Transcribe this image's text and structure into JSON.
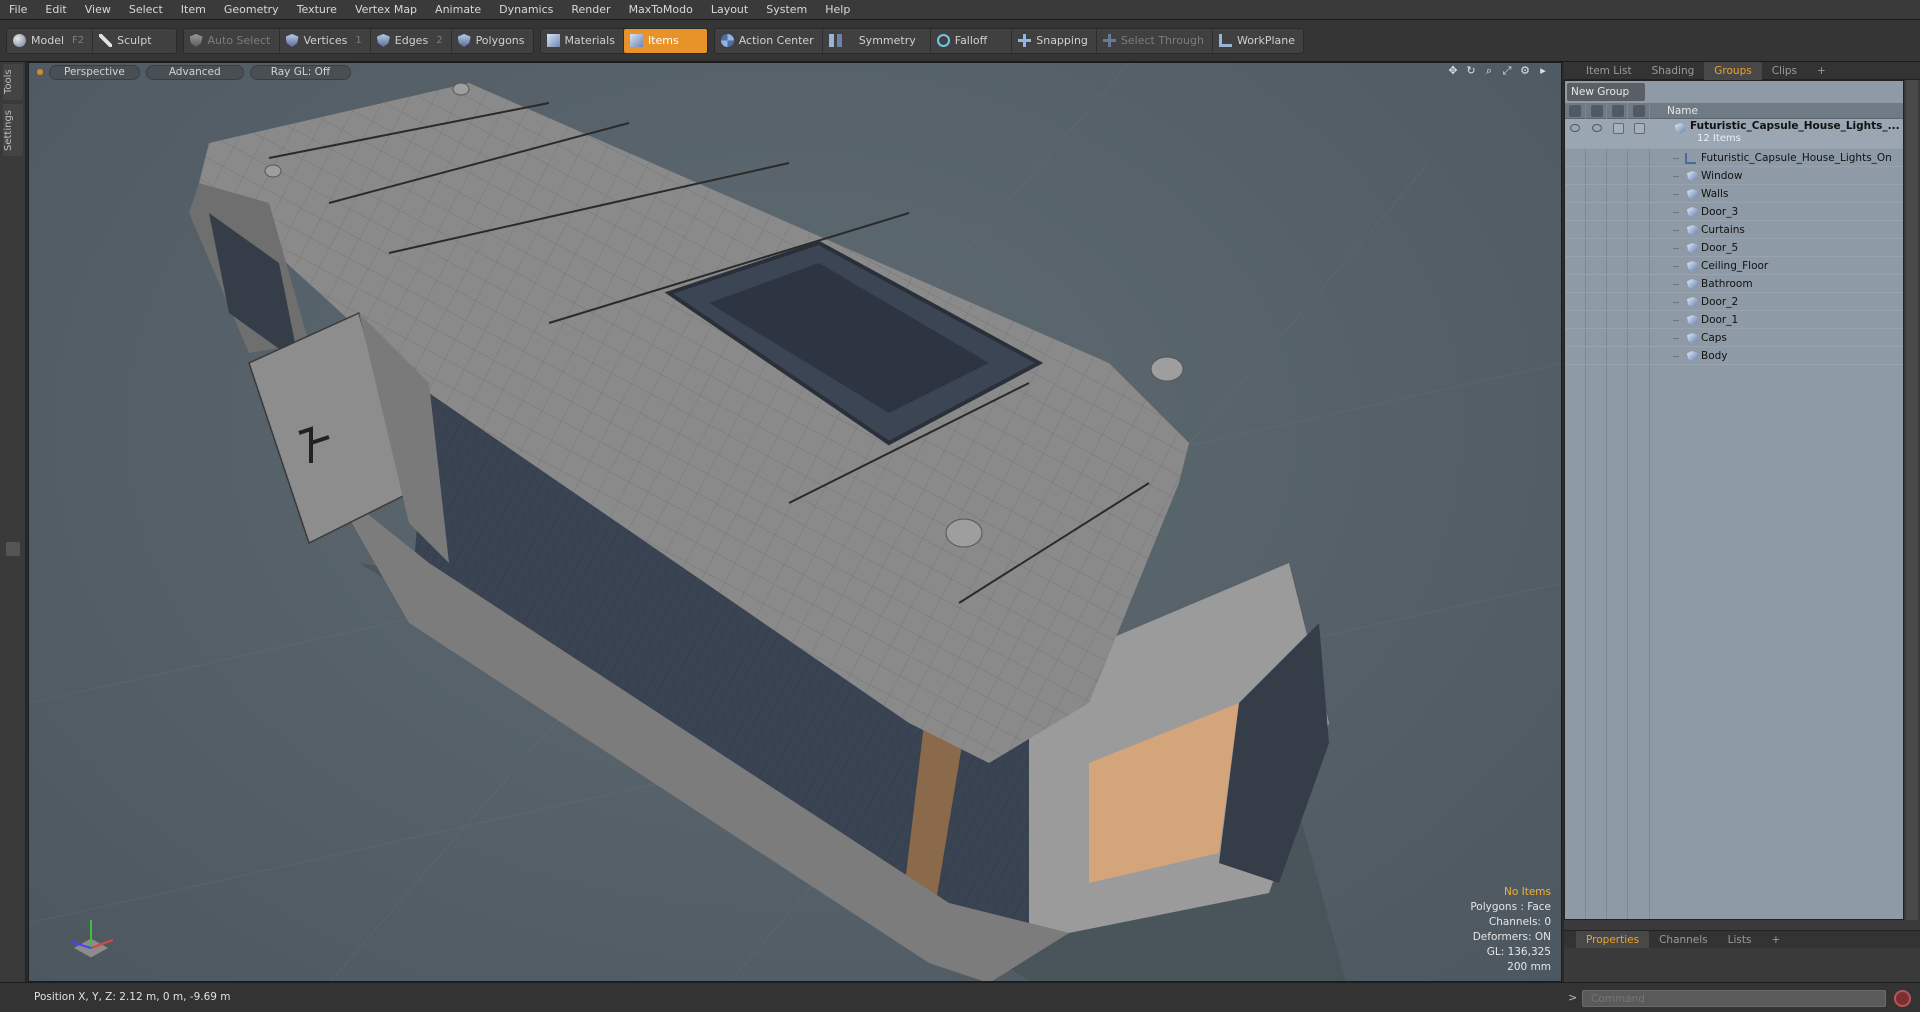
{
  "menu": [
    "File",
    "Edit",
    "View",
    "Select",
    "Item",
    "Geometry",
    "Texture",
    "Vertex Map",
    "Animate",
    "Dynamics",
    "Render",
    "MaxToModo",
    "Layout",
    "System",
    "Help"
  ],
  "toolbar": {
    "model": "Model",
    "model_key": "F2",
    "sculpt": "Sculpt",
    "auto_select": "Auto Select",
    "vertices": "Vertices",
    "vertices_key": "1",
    "edges": "Edges",
    "edges_key": "2",
    "polygons": "Polygons",
    "materials": "Materials",
    "items": "Items",
    "action_center": "Action Center",
    "symmetry": "Symmetry",
    "falloff": "Falloff",
    "snapping": "Snapping",
    "select_through": "Select Through",
    "workplane": "WorkPlane"
  },
  "left_tabs": {
    "tools": "Tools",
    "settings": "Settings"
  },
  "viewport": {
    "view_mode": "Perspective",
    "shading": "Advanced",
    "raygl": "Ray GL: Off",
    "info": {
      "selection": "No Items",
      "polygons": "Polygons : Face",
      "channels": "Channels: 0",
      "deformers": "Deformers: ON",
      "gl": "GL: 136,325",
      "scale": "200 mm"
    },
    "colors": {
      "background": "#56626a",
      "model": "#8a8a8a",
      "glass": "#3a4352",
      "wood": "#c99a6a"
    }
  },
  "right_panel": {
    "tabs": [
      "Item List",
      "Shading",
      "Groups",
      "Clips"
    ],
    "active_tab": "Groups",
    "add_tab": "+",
    "new_group": "New Group",
    "name_header": "Name",
    "root": {
      "name": "Futuristic_Capsule_House_Lights_...",
      "count": "12 Items"
    },
    "items": [
      "Futuristic_Capsule_House_Lights_On",
      "Window",
      "Walls",
      "Door_3",
      "Curtains",
      "Door_5",
      "Ceiling_Floor",
      "Bathroom",
      "Door_2",
      "Door_1",
      "Caps",
      "Body"
    ],
    "bottom_tabs": [
      "Properties",
      "Channels",
      "Lists"
    ],
    "bottom_active": "Properties"
  },
  "status": {
    "position": "Position X, Y, Z:   2.12 m, 0 m, -9.69 m",
    "command_placeholder": "Command",
    "prompt": ">"
  }
}
